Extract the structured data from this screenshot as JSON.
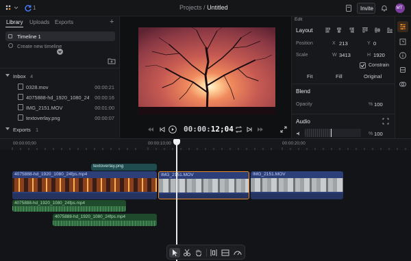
{
  "header": {
    "badge_count": "1",
    "breadcrumb_prefix": "Projects",
    "breadcrumb_sep": "/",
    "project_name": "Untitled",
    "invite_label": "Invite",
    "avatar_initials": "MT"
  },
  "library": {
    "tabs": [
      "Library",
      "Uploads",
      "Exports"
    ],
    "add_symbol": "+",
    "timeline_name": "Timeline 1",
    "create_label": "Create new timeline",
    "inbox": {
      "label": "Inbox",
      "count": "4"
    },
    "files": [
      {
        "name": "0328.mov",
        "duration": "00:00:21"
      },
      {
        "name": "4075888-hd_1920_1080_24f...",
        "duration": "00:00:16"
      },
      {
        "name": "IMG_2151.MOV",
        "duration": "00:01:00"
      },
      {
        "name": "textoverlay.png",
        "duration": "00:00:07"
      }
    ],
    "exports_label": "Exports",
    "exports_count": "1"
  },
  "viewer": {
    "timecode_prefix": "00:00:",
    "timecode_main": "12;04"
  },
  "edit_panel": {
    "title": "Edit",
    "layout_label": "Layout",
    "position_label": "Position",
    "x_label": "X",
    "x_value": "213",
    "y_label": "Y",
    "y_value": "0",
    "scale_label": "Scale",
    "w_label": "W",
    "w_value": "3413",
    "h_label": "H",
    "h_value": "1920",
    "constrain_label": "Constrain",
    "constrain_checked": true,
    "fit_options": [
      "Fit",
      "Fill",
      "Original"
    ],
    "blend_label": "Blend",
    "opacity_label": "Opacity",
    "opacity_unit": "%",
    "opacity_value": "100",
    "audio_label": "Audio",
    "audio_unit": "%",
    "audio_value": "100"
  },
  "timeline": {
    "ruler_labels": [
      "00:00:00;00",
      "00:00:10;00",
      "00:00:20;00"
    ],
    "playhead_time": "00:00:12;04",
    "tracks": {
      "overlay_clip": "textoverlay.png",
      "video_clips": [
        "4075888-hd_1920_1080_24fps.mp4",
        "IMG_2151.MOV",
        "IMG_2151.MOV"
      ],
      "audio_clips": [
        "4075888-hd_1920_1080_24fps.mp4",
        "4075888-hd_1920_1080_24fps.mp4"
      ]
    }
  },
  "colors": {
    "accent": "#e8892a",
    "video_clip": "#2d3f78",
    "video_clip_label": "#c7d3ff",
    "audio_clip": "#1f4b2c",
    "overlay_clip": "#1f4d4f",
    "avatar": "#7a3d9e"
  },
  "icons": {
    "app_menu": "grid-icon",
    "sync": "sync-icon",
    "notes": "document-icon",
    "bell": "bell-icon",
    "folder": "folder-add-icon"
  }
}
